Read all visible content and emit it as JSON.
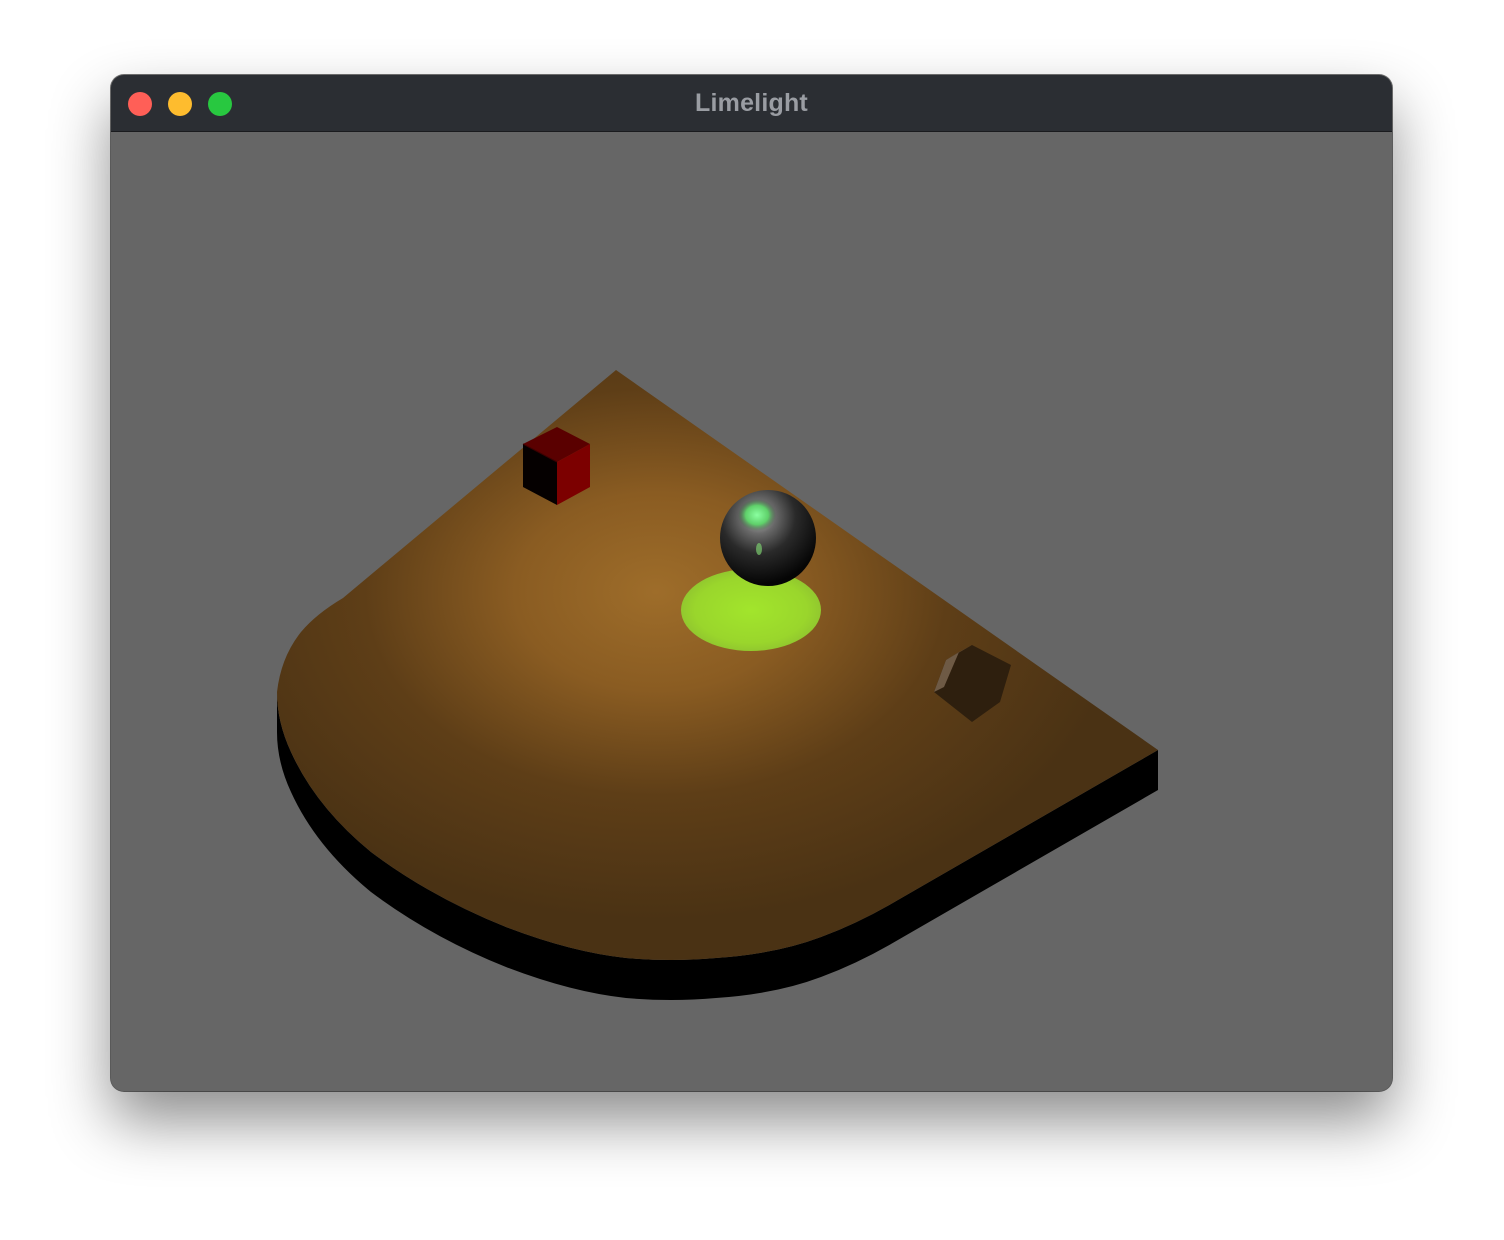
{
  "window": {
    "title": "Limelight",
    "controls": {
      "close_color": "#ff5f57",
      "minimize_color": "#febc2e",
      "zoom_color": "#28c840"
    }
  },
  "scene": {
    "background_color": "#666666",
    "floor_color": "#9a6a28",
    "floor_side_color": "#000000",
    "spotlight_color": "#9ee030",
    "objects": [
      {
        "name": "cube",
        "color": "#8b0000"
      },
      {
        "name": "sphere",
        "color": "#111111",
        "highlight_color": "#66ee77"
      },
      {
        "name": "hexagonal-prism",
        "color": "#3a2810"
      }
    ]
  }
}
